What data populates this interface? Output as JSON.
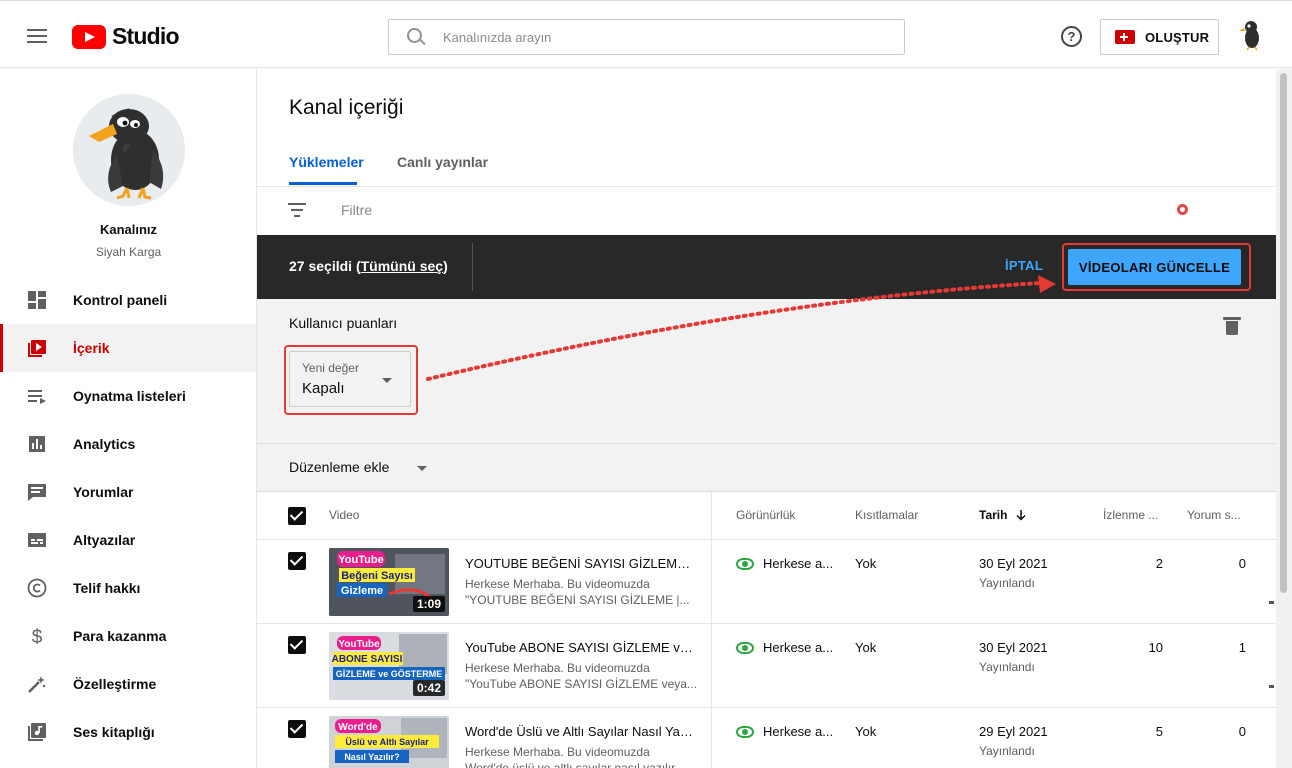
{
  "header": {
    "logo_text": "Studio",
    "search_placeholder": "Kanalınızda arayın",
    "help_glyph": "?",
    "create_label": "OLUŞTUR"
  },
  "sidebar": {
    "channel_name": "Kanalınız",
    "channel_handle": "Siyah Karga",
    "items": [
      {
        "label": "Kontrol paneli",
        "icon": "dashboard-icon"
      },
      {
        "label": "İçerik",
        "icon": "content-icon",
        "active": true
      },
      {
        "label": "Oynatma listeleri",
        "icon": "playlists-icon"
      },
      {
        "label": "Analytics",
        "icon": "analytics-icon"
      },
      {
        "label": "Yorumlar",
        "icon": "comments-icon"
      },
      {
        "label": "Altyazılar",
        "icon": "subtitles-icon"
      },
      {
        "label": "Telif hakkı",
        "icon": "copyright-icon"
      },
      {
        "label": "Para kazanma",
        "icon": "dollar-icon"
      },
      {
        "label": "Özelleştirme",
        "icon": "magic-wand-icon"
      },
      {
        "label": "Ses kitaplığı",
        "icon": "audio-library-icon"
      }
    ]
  },
  "main": {
    "title": "Kanal içeriği",
    "tabs": [
      {
        "label": "Yüklemeler",
        "active": true
      },
      {
        "label": "Canlı yayınlar"
      }
    ],
    "filter_placeholder": "Filtre",
    "selection": {
      "count_text": "27 seçildi",
      "open_paren": "(",
      "select_all": "Tümünü seç",
      "close_paren": ")",
      "cancel": "İPTAL",
      "update": "VİDEOLARI GÜNCELLE"
    },
    "edit_panel": {
      "title": "Kullanıcı puanları",
      "field_caption": "Yeni değer",
      "field_value": "Kapalı"
    },
    "add_edit_label": "Düzenleme ekle",
    "table": {
      "headers": {
        "video": "Video",
        "visibility": "Görünürlük",
        "restrictions": "Kısıtlamalar",
        "date": "Tarih",
        "views": "İzlenme ...",
        "comments": "Yorum s..."
      },
      "rows": [
        {
          "title": "YOUTUBE BEĞENİ SAYISI GİZLEME | B...",
          "desc1": "Herkese Merhaba. Bu videomuzda",
          "desc2": "\"YOUTUBE BEĞENİ SAYISI GİZLEME |...",
          "thumb_line1": "YouTube",
          "thumb_line2": "Beğeni Sayısı",
          "thumb_line3": "Gizleme",
          "duration": "1:09",
          "visibility": "Herkese a...",
          "restrictions": "Yok",
          "date": "30 Eyl 2021",
          "status": "Yayınlandı",
          "views": "2",
          "comments": "0"
        },
        {
          "title": "YouTube ABONE SAYISI GİZLEME vey...",
          "desc1": "Herkese Merhaba. Bu videomuzda",
          "desc2": "\"YouTube ABONE SAYISI GİZLEME veya...",
          "thumb_line1": "YouTube",
          "thumb_line2": "ABONE SAYISI",
          "thumb_line3": "GİZLEME ve GÖSTERME",
          "duration": "0:42",
          "visibility": "Herkese a...",
          "restrictions": "Yok",
          "date": "30 Eyl 2021",
          "status": "Yayınlandı",
          "views": "10",
          "comments": "1"
        },
        {
          "title": "Word'de Üslü ve Altlı Sayılar Nasıl Yazı...",
          "desc1": "Herkese Merhaba. Bu videomuzda",
          "desc2": "Word'de üslü ve altlı sayılar nasıl yazılır...",
          "thumb_line1": "Word'de",
          "thumb_line2": "Üslü ve Altlı Sayılar",
          "thumb_line3": "Nasıl Yazılır?",
          "duration": "",
          "visibility": "Herkese a...",
          "restrictions": "Yok",
          "date": "29 Eyl 2021",
          "status": "Yayınlandı",
          "views": "5",
          "comments": "0"
        }
      ]
    }
  },
  "colors": {
    "brand_red": "#ff0000",
    "active_red": "#cc0000",
    "link_blue": "#065fd4",
    "button_blue": "#3ea6ff",
    "visibility_green": "#2ba640",
    "annotation_red": "#e53935"
  }
}
